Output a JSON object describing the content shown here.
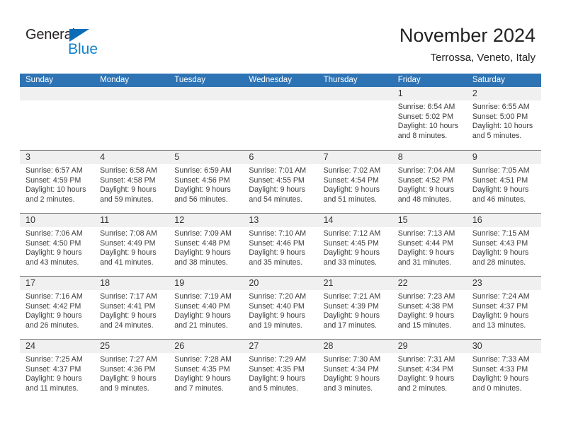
{
  "brand": {
    "name_top": "General",
    "name_bottom": "Blue",
    "triangle_color": "#0c6cb5",
    "blue_color": "#1383cb"
  },
  "header": {
    "title": "November 2024",
    "location": "Terrossa, Veneto, Italy"
  },
  "theme": {
    "header_blue": "#2e74b5",
    "date_band": "#f0f0f0",
    "row_rule": "#808080",
    "text": "#3a3a3a"
  },
  "weekdays": [
    "Sunday",
    "Monday",
    "Tuesday",
    "Wednesday",
    "Thursday",
    "Friday",
    "Saturday"
  ],
  "weeks": [
    [
      {
        "date": "",
        "lines": []
      },
      {
        "date": "",
        "lines": []
      },
      {
        "date": "",
        "lines": []
      },
      {
        "date": "",
        "lines": []
      },
      {
        "date": "",
        "lines": []
      },
      {
        "date": "1",
        "lines": [
          "Sunrise: 6:54 AM",
          "Sunset: 5:02 PM",
          "Daylight: 10 hours",
          "and 8 minutes."
        ]
      },
      {
        "date": "2",
        "lines": [
          "Sunrise: 6:55 AM",
          "Sunset: 5:00 PM",
          "Daylight: 10 hours",
          "and 5 minutes."
        ]
      }
    ],
    [
      {
        "date": "3",
        "lines": [
          "Sunrise: 6:57 AM",
          "Sunset: 4:59 PM",
          "Daylight: 10 hours",
          "and 2 minutes."
        ]
      },
      {
        "date": "4",
        "lines": [
          "Sunrise: 6:58 AM",
          "Sunset: 4:58 PM",
          "Daylight: 9 hours",
          "and 59 minutes."
        ]
      },
      {
        "date": "5",
        "lines": [
          "Sunrise: 6:59 AM",
          "Sunset: 4:56 PM",
          "Daylight: 9 hours",
          "and 56 minutes."
        ]
      },
      {
        "date": "6",
        "lines": [
          "Sunrise: 7:01 AM",
          "Sunset: 4:55 PM",
          "Daylight: 9 hours",
          "and 54 minutes."
        ]
      },
      {
        "date": "7",
        "lines": [
          "Sunrise: 7:02 AM",
          "Sunset: 4:54 PM",
          "Daylight: 9 hours",
          "and 51 minutes."
        ]
      },
      {
        "date": "8",
        "lines": [
          "Sunrise: 7:04 AM",
          "Sunset: 4:52 PM",
          "Daylight: 9 hours",
          "and 48 minutes."
        ]
      },
      {
        "date": "9",
        "lines": [
          "Sunrise: 7:05 AM",
          "Sunset: 4:51 PM",
          "Daylight: 9 hours",
          "and 46 minutes."
        ]
      }
    ],
    [
      {
        "date": "10",
        "lines": [
          "Sunrise: 7:06 AM",
          "Sunset: 4:50 PM",
          "Daylight: 9 hours",
          "and 43 minutes."
        ]
      },
      {
        "date": "11",
        "lines": [
          "Sunrise: 7:08 AM",
          "Sunset: 4:49 PM",
          "Daylight: 9 hours",
          "and 41 minutes."
        ]
      },
      {
        "date": "12",
        "lines": [
          "Sunrise: 7:09 AM",
          "Sunset: 4:48 PM",
          "Daylight: 9 hours",
          "and 38 minutes."
        ]
      },
      {
        "date": "13",
        "lines": [
          "Sunrise: 7:10 AM",
          "Sunset: 4:46 PM",
          "Daylight: 9 hours",
          "and 35 minutes."
        ]
      },
      {
        "date": "14",
        "lines": [
          "Sunrise: 7:12 AM",
          "Sunset: 4:45 PM",
          "Daylight: 9 hours",
          "and 33 minutes."
        ]
      },
      {
        "date": "15",
        "lines": [
          "Sunrise: 7:13 AM",
          "Sunset: 4:44 PM",
          "Daylight: 9 hours",
          "and 31 minutes."
        ]
      },
      {
        "date": "16",
        "lines": [
          "Sunrise: 7:15 AM",
          "Sunset: 4:43 PM",
          "Daylight: 9 hours",
          "and 28 minutes."
        ]
      }
    ],
    [
      {
        "date": "17",
        "lines": [
          "Sunrise: 7:16 AM",
          "Sunset: 4:42 PM",
          "Daylight: 9 hours",
          "and 26 minutes."
        ]
      },
      {
        "date": "18",
        "lines": [
          "Sunrise: 7:17 AM",
          "Sunset: 4:41 PM",
          "Daylight: 9 hours",
          "and 24 minutes."
        ]
      },
      {
        "date": "19",
        "lines": [
          "Sunrise: 7:19 AM",
          "Sunset: 4:40 PM",
          "Daylight: 9 hours",
          "and 21 minutes."
        ]
      },
      {
        "date": "20",
        "lines": [
          "Sunrise: 7:20 AM",
          "Sunset: 4:40 PM",
          "Daylight: 9 hours",
          "and 19 minutes."
        ]
      },
      {
        "date": "21",
        "lines": [
          "Sunrise: 7:21 AM",
          "Sunset: 4:39 PM",
          "Daylight: 9 hours",
          "and 17 minutes."
        ]
      },
      {
        "date": "22",
        "lines": [
          "Sunrise: 7:23 AM",
          "Sunset: 4:38 PM",
          "Daylight: 9 hours",
          "and 15 minutes."
        ]
      },
      {
        "date": "23",
        "lines": [
          "Sunrise: 7:24 AM",
          "Sunset: 4:37 PM",
          "Daylight: 9 hours",
          "and 13 minutes."
        ]
      }
    ],
    [
      {
        "date": "24",
        "lines": [
          "Sunrise: 7:25 AM",
          "Sunset: 4:37 PM",
          "Daylight: 9 hours",
          "and 11 minutes."
        ]
      },
      {
        "date": "25",
        "lines": [
          "Sunrise: 7:27 AM",
          "Sunset: 4:36 PM",
          "Daylight: 9 hours",
          "and 9 minutes."
        ]
      },
      {
        "date": "26",
        "lines": [
          "Sunrise: 7:28 AM",
          "Sunset: 4:35 PM",
          "Daylight: 9 hours",
          "and 7 minutes."
        ]
      },
      {
        "date": "27",
        "lines": [
          "Sunrise: 7:29 AM",
          "Sunset: 4:35 PM",
          "Daylight: 9 hours",
          "and 5 minutes."
        ]
      },
      {
        "date": "28",
        "lines": [
          "Sunrise: 7:30 AM",
          "Sunset: 4:34 PM",
          "Daylight: 9 hours",
          "and 3 minutes."
        ]
      },
      {
        "date": "29",
        "lines": [
          "Sunrise: 7:31 AM",
          "Sunset: 4:34 PM",
          "Daylight: 9 hours",
          "and 2 minutes."
        ]
      },
      {
        "date": "30",
        "lines": [
          "Sunrise: 7:33 AM",
          "Sunset: 4:33 PM",
          "Daylight: 9 hours",
          "and 0 minutes."
        ]
      }
    ]
  ]
}
